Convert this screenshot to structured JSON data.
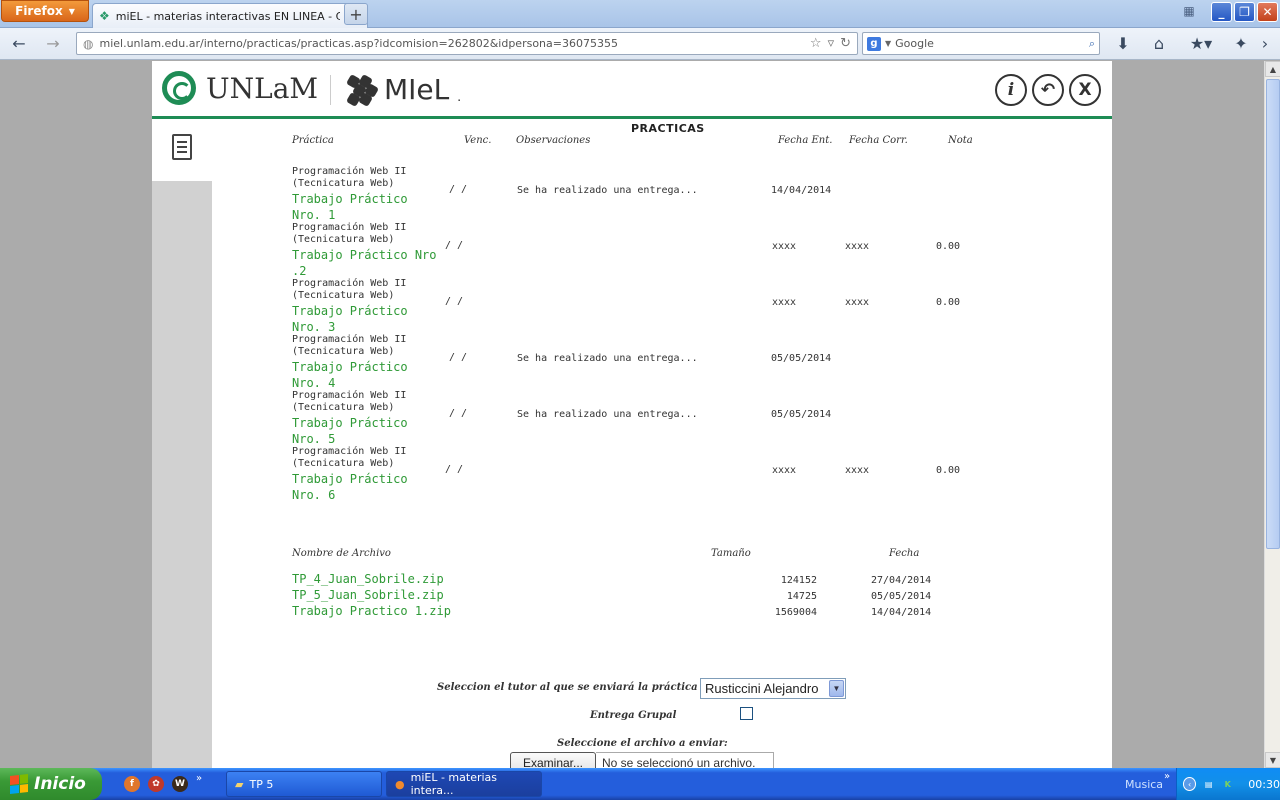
{
  "browser": {
    "app_button": "Firefox",
    "tab_title": "miEL - materias interactivas EN LINEA - Cam...",
    "url": "miel.unlam.edu.ar/interno/practicas/practicas.asp?idcomision=262802&idpersona=36075355",
    "search_engine": "Google",
    "search_placeholder": "Google"
  },
  "header": {
    "logo_unlam": "UNLaM",
    "logo_miel": "MIeL",
    "dot": "."
  },
  "practicas": {
    "title": "PRACTICAS",
    "columns": {
      "practica": "Práctica",
      "venc": "Venc.",
      "observaciones": "Observaciones",
      "fecha_ent": "Fecha Ent.",
      "fecha_corr": "Fecha Corr.",
      "nota": "Nota"
    },
    "rows": [
      {
        "course_line1": "Programación Web II",
        "course_line2": "(Tecnicatura Web)",
        "link": "Trabajo Práctico Nro. 1",
        "venc": "/ /",
        "obs": "Se ha realizado una entrega...",
        "fecha_ent": "14/04/2014",
        "fecha_corr": "",
        "nota": ""
      },
      {
        "course_line1": "Programación Web II",
        "course_line2": "(Tecnicatura Web)",
        "link": "Trabajo Práctico Nro .2",
        "venc": "/ /",
        "obs": "",
        "fecha_ent": "xxxx",
        "fecha_corr": "xxxx",
        "nota": "0.00"
      },
      {
        "course_line1": "Programación Web II",
        "course_line2": "(Tecnicatura Web)",
        "link": "Trabajo Práctico Nro. 3",
        "venc": "/ /",
        "obs": "",
        "fecha_ent": "xxxx",
        "fecha_corr": "xxxx",
        "nota": "0.00"
      },
      {
        "course_line1": "Programación Web II",
        "course_line2": "(Tecnicatura Web)",
        "link": "Trabajo Práctico Nro. 4",
        "venc": "/ /",
        "obs": "Se ha realizado una entrega...",
        "fecha_ent": "05/05/2014",
        "fecha_corr": "",
        "nota": ""
      },
      {
        "course_line1": "Programación Web II",
        "course_line2": "(Tecnicatura Web)",
        "link": "Trabajo Práctico Nro. 5",
        "venc": "/ /",
        "obs": "Se ha realizado una entrega...",
        "fecha_ent": "05/05/2014",
        "fecha_corr": "",
        "nota": ""
      },
      {
        "course_line1": "Programación Web II",
        "course_line2": "(Tecnicatura Web)",
        "link": "Trabajo Práctico Nro. 6",
        "venc": "/ /",
        "obs": "",
        "fecha_ent": "xxxx",
        "fecha_corr": "xxxx",
        "nota": "0.00"
      }
    ]
  },
  "archivos": {
    "columns": {
      "nombre": "Nombre de Archivo",
      "tamano": "Tamaño",
      "fecha": "Fecha"
    },
    "rows": [
      {
        "name": "TP_4_Juan_Sobrile.zip",
        "size": "124152",
        "date": "27/04/2014"
      },
      {
        "name": "TP_5_Juan_Sobrile.zip",
        "size": "14725",
        "date": "05/05/2014"
      },
      {
        "name": "Trabajo Practico 1.zip",
        "size": "1569004",
        "date": "14/04/2014"
      }
    ]
  },
  "form": {
    "tutor_label": "Seleccion el tutor al que se enviará la práctica",
    "tutor_value": "Rusticcini Alejandro",
    "group_label": "Entrega Grupal",
    "group_checked": false,
    "file_label": "Seleccione el archivo a enviar:",
    "browse_button": "Examinar...",
    "file_status": "No se seleccionó un archivo."
  },
  "taskbar": {
    "start": "Inicio",
    "tasks": [
      "TP 5",
      "miEL - materias intera..."
    ],
    "tray_label": "Musica",
    "clock": "00:30"
  },
  "colors": {
    "brand_green": "#1e8c55",
    "link_green": "#2f9a37"
  }
}
